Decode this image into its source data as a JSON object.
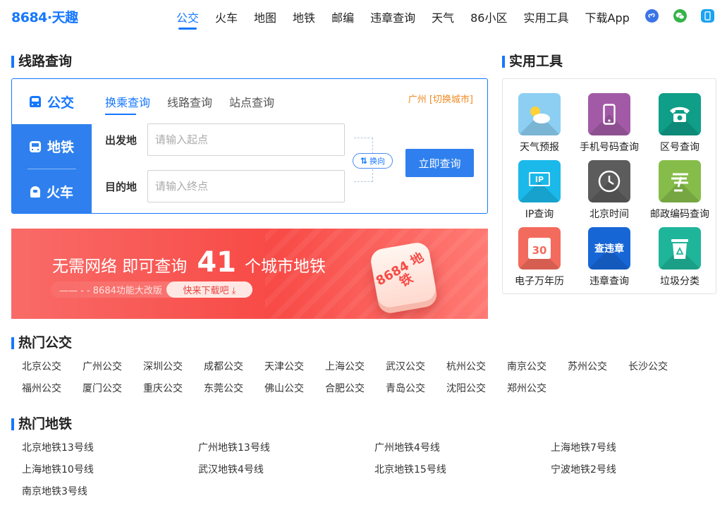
{
  "header": {
    "logo": "8684·天趣",
    "nav": [
      "公交",
      "火车",
      "地图",
      "地铁",
      "邮编",
      "违章查询",
      "天气",
      "86小区",
      "实用工具",
      "下载App"
    ],
    "active_nav": "公交",
    "social_icons": [
      "miniprogram-icon",
      "wechat-icon",
      "phone-icon"
    ]
  },
  "route_query": {
    "title": "线路查询",
    "side": [
      "公交",
      "地铁",
      "火车"
    ],
    "tabs": [
      "换乘查询",
      "线路查询",
      "站点查询"
    ],
    "city_label": "广州 [切换城市]",
    "from_label": "出发地",
    "from_placeholder": "请输入起点",
    "to_label": "目的地",
    "to_placeholder": "请输入终点",
    "swap_label": "换向",
    "query_button": "立即查询"
  },
  "banner": {
    "text_before": "无需网络 即可查询",
    "number": "41",
    "text_after": "个城市地铁",
    "sub": "—— - -  8684功能大改版",
    "download": "快来下载吧 ⤓",
    "app_text": "8684 地铁"
  },
  "tools": {
    "title": "实用工具",
    "items": [
      {
        "label": "天气预报",
        "icon": "weather-icon",
        "color": "#8ccff2"
      },
      {
        "label": "手机号码查询",
        "icon": "mobile-phone-icon",
        "color": "#a25aa6"
      },
      {
        "label": "区号查询",
        "icon": "telephone-icon",
        "color": "#0f9e88"
      },
      {
        "label": "IP查询",
        "icon": "ip-monitor-icon",
        "color": "#1ab9ea"
      },
      {
        "label": "北京时间",
        "icon": "clock-icon",
        "color": "#5c5c5c"
      },
      {
        "label": "邮政编码查询",
        "icon": "post-icon",
        "color": "#86bd4a"
      },
      {
        "label": "电子万年历",
        "icon": "calendar-icon",
        "color": "#f36b5d"
      },
      {
        "label": "违章查询",
        "icon": "traffic-violation-icon",
        "color": "#1766d6"
      },
      {
        "label": "垃圾分类",
        "icon": "recycle-icon",
        "color": "#1fb59a"
      }
    ],
    "calendar_day": "30",
    "violation_text": "查违章",
    "ip_text": "IP"
  },
  "hot_bus": {
    "title": "热门公交",
    "items": [
      "北京公交",
      "广州公交",
      "深圳公交",
      "成都公交",
      "天津公交",
      "上海公交",
      "武汉公交",
      "杭州公交",
      "南京公交",
      "苏州公交",
      "长沙公交",
      "福州公交",
      "厦门公交",
      "重庆公交",
      "东莞公交",
      "佛山公交",
      "合肥公交",
      "青岛公交",
      "沈阳公交",
      "郑州公交"
    ]
  },
  "hot_metro": {
    "title": "热门地铁",
    "items": [
      "北京地铁13号线",
      "广州地铁13号线",
      "广州地铁4号线",
      "上海地铁7号线",
      "上海地铁10号线",
      "武汉地铁4号线",
      "北京地铁15号线",
      "宁波地铁2号线",
      "南京地铁3号线"
    ]
  },
  "colors": {
    "accent": "#1677ff",
    "side_blue": "#2f80ee",
    "city_orange": "#f08a24",
    "banner_red": "#f84a46"
  }
}
